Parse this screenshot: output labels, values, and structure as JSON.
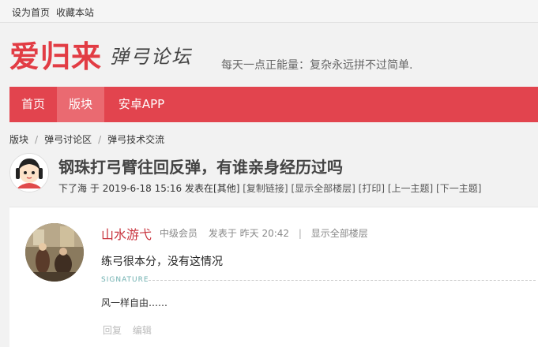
{
  "topbar": {
    "set_home": "设为首页",
    "bookmark": "收藏本站"
  },
  "header": {
    "logo_main": "爱归来",
    "logo_sub": "弹弓论坛",
    "slogan": "每天一点正能量：复杂永远拼不过简单."
  },
  "nav": {
    "items": [
      "首页",
      "版块",
      "安卓APP"
    ],
    "active_index": 1
  },
  "breadcrumb": {
    "items": [
      "版块",
      "弹弓讨论区",
      "弹弓技术交流"
    ]
  },
  "thread": {
    "title": "钢珠打弓臂往回反弹，有谁亲身经历过吗",
    "author": "下了海",
    "posted_prefix": "于",
    "date": "2019-6-18 15:16",
    "posted_in": "发表在",
    "forum": "[其他]",
    "links": [
      "[复制链接]",
      "[显示全部楼层]",
      "[打印]",
      "[上一主题]",
      "[下一主题]"
    ]
  },
  "post": {
    "author": "山水游弋",
    "level": "中级会员",
    "posted": "发表于 昨天 20:42",
    "separator": "|",
    "show_all": "显示全部楼层",
    "body": "练弓很本分，没有这情况",
    "signature_label": "SIGNATURE",
    "signature": "风一样自由……",
    "actions": [
      "回复",
      "编辑"
    ]
  },
  "colors": {
    "accent": "#e2444e",
    "nav_active": "#ea6a71",
    "author": "#c8323c"
  }
}
